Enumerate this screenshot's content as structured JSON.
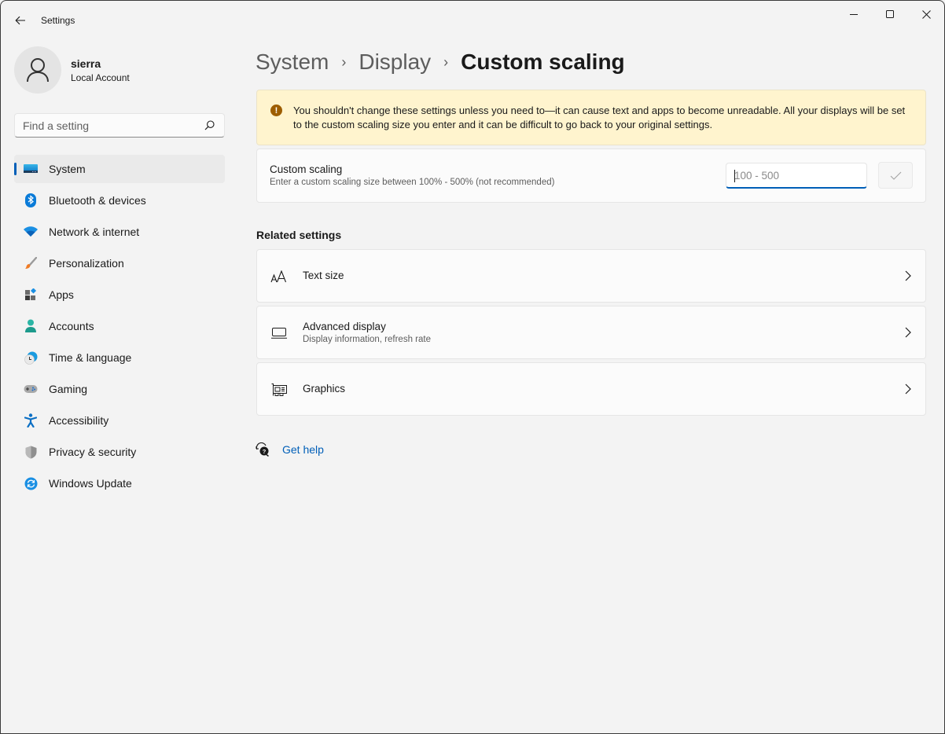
{
  "window": {
    "title": "Settings",
    "controls": {
      "minimize": "minimize-icon",
      "maximize": "maximize-icon",
      "close": "close-icon"
    }
  },
  "profile": {
    "name": "sierra",
    "account_type": "Local Account"
  },
  "search": {
    "placeholder": "Find a setting",
    "value": ""
  },
  "sidebar": {
    "items": [
      {
        "label": "System",
        "icon": "system-icon",
        "active": true
      },
      {
        "label": "Bluetooth & devices",
        "icon": "bluetooth-icon",
        "active": false
      },
      {
        "label": "Network & internet",
        "icon": "wifi-icon",
        "active": false
      },
      {
        "label": "Personalization",
        "icon": "paintbrush-icon",
        "active": false
      },
      {
        "label": "Apps",
        "icon": "apps-icon",
        "active": false
      },
      {
        "label": "Accounts",
        "icon": "accounts-icon",
        "active": false
      },
      {
        "label": "Time & language",
        "icon": "clock-globe-icon",
        "active": false
      },
      {
        "label": "Gaming",
        "icon": "gamepad-icon",
        "active": false
      },
      {
        "label": "Accessibility",
        "icon": "accessibility-icon",
        "active": false
      },
      {
        "label": "Privacy & security",
        "icon": "shield-icon",
        "active": false
      },
      {
        "label": "Windows Update",
        "icon": "update-icon",
        "active": false
      }
    ]
  },
  "breadcrumb": {
    "items": [
      "System",
      "Display"
    ],
    "current": "Custom scaling",
    "separator": "›"
  },
  "warning": {
    "icon": "warning-icon",
    "glyph": "!",
    "text": "You shouldn't change these settings unless you need to—it can cause text and apps to become unreadable. All your displays will be set to the custom scaling size you enter and it can be difficult to go back to your original settings."
  },
  "custom_scaling": {
    "title": "Custom scaling",
    "description": "Enter a custom scaling size between 100% - 500% (not recommended)",
    "input_placeholder": "100 - 500",
    "input_value": "",
    "apply_icon": "checkmark-icon"
  },
  "related": {
    "title": "Related settings",
    "items": [
      {
        "title": "Text size",
        "subtitle": "",
        "icon": "text-size-icon"
      },
      {
        "title": "Advanced display",
        "subtitle": "Display information, refresh rate",
        "icon": "monitor-icon"
      },
      {
        "title": "Graphics",
        "subtitle": "",
        "icon": "graphics-card-icon"
      }
    ]
  },
  "help": {
    "label": "Get help",
    "icon": "help-icon"
  },
  "colors": {
    "accent": "#005fb8",
    "warning_bg": "#fff4ce",
    "warning_icon": "#9d5d00",
    "window_bg": "#f3f3f3",
    "card_bg": "#fbfbfb"
  }
}
